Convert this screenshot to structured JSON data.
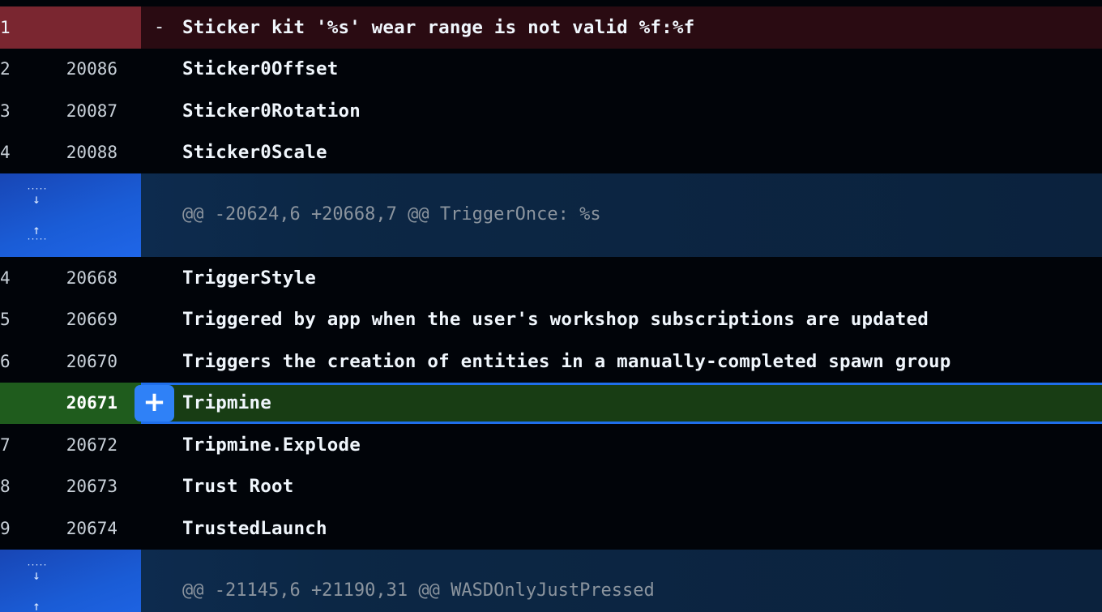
{
  "diff": {
    "rows": [
      {
        "type": "deleted",
        "old": "1",
        "new": "",
        "marker": "-",
        "code": "Sticker kit '%s' wear range is not valid %f:%f"
      },
      {
        "type": "context",
        "old": "2",
        "new": "20086",
        "marker": "",
        "code": "Sticker0Offset"
      },
      {
        "type": "context",
        "old": "3",
        "new": "20087",
        "marker": "",
        "code": "Sticker0Rotation"
      },
      {
        "type": "context",
        "old": "4",
        "new": "20088",
        "marker": "",
        "code": "Sticker0Scale"
      },
      {
        "type": "hunk",
        "code": "@@ -20624,6 +20668,7 @@ TriggerOnce: %s"
      },
      {
        "type": "context",
        "old": "4",
        "new": "20668",
        "marker": "",
        "code": "TriggerStyle"
      },
      {
        "type": "context",
        "old": "5",
        "new": "20669",
        "marker": "",
        "code": "Triggered by app when the user's workshop subscriptions are updated"
      },
      {
        "type": "context",
        "old": "6",
        "new": "20670",
        "marker": "",
        "code": "Triggers the creation of entities in a manually-completed spawn group"
      },
      {
        "type": "added",
        "old": "",
        "new": "20671",
        "marker": "+",
        "code": "Tripmine"
      },
      {
        "type": "context",
        "old": "7",
        "new": "20672",
        "marker": "",
        "code": "Tripmine.Explode"
      },
      {
        "type": "context",
        "old": "8",
        "new": "20673",
        "marker": "",
        "code": "Trust Root"
      },
      {
        "type": "context",
        "old": "9",
        "new": "20674",
        "marker": "",
        "code": "TrustedLaunch"
      },
      {
        "type": "hunk",
        "code": "@@ -21145,6 +21190,31 @@ WASDOnlyJustPressed"
      }
    ],
    "expand_down_icon": "arrow-down-icon",
    "expand_up_icon": "arrow-up-icon",
    "add_comment_icon": "plus-icon"
  },
  "colors": {
    "background": "#010409",
    "deleted_gutter": "#7a2630",
    "deleted_row": "#2a0b12",
    "added_gutter": "#1f5c1d",
    "added_row": "#183d14",
    "hunk_gutter": "#1a5cd6",
    "hunk_row": "#0c2745",
    "accent": "#2f81f7"
  }
}
